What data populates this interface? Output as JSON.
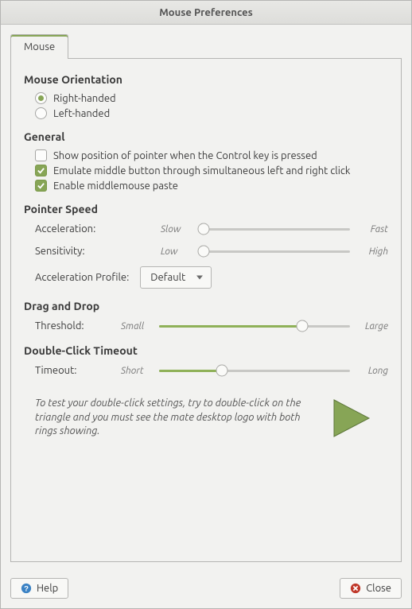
{
  "window": {
    "title": "Mouse Preferences"
  },
  "tab": {
    "label": "Mouse"
  },
  "orientation": {
    "title": "Mouse Orientation",
    "right": "Right-handed",
    "left": "Left-handed",
    "selected": "right"
  },
  "general": {
    "title": "General",
    "show_pointer": "Show position of pointer when the Control key is pressed",
    "emulate_middle": "Emulate middle button through simultaneous left and right click",
    "enable_paste": "Enable middlemouse paste",
    "checked": {
      "show_pointer": false,
      "emulate_middle": true,
      "enable_paste": true
    }
  },
  "pointer_speed": {
    "title": "Pointer Speed",
    "accel_label": "Acceleration:",
    "accel_min": "Slow",
    "accel_max": "Fast",
    "accel_pos": 0.03,
    "sens_label": "Sensitivity:",
    "sens_min": "Low",
    "sens_max": "High",
    "sens_pos": 0.03,
    "profile_label": "Acceleration Profile:",
    "profile_value": "Default"
  },
  "drag": {
    "title": "Drag and Drop",
    "threshold_label": "Threshold:",
    "min": "Small",
    "max": "Large",
    "pos": 0.75
  },
  "double_click": {
    "title": "Double-Click Timeout",
    "timeout_label": "Timeout:",
    "min": "Short",
    "max": "Long",
    "pos": 0.33,
    "hint": "To test your double-click settings, try to double-click on the triangle and you must see the mate desktop logo with both rings showing."
  },
  "footer": {
    "help": "Help",
    "close": "Close"
  }
}
